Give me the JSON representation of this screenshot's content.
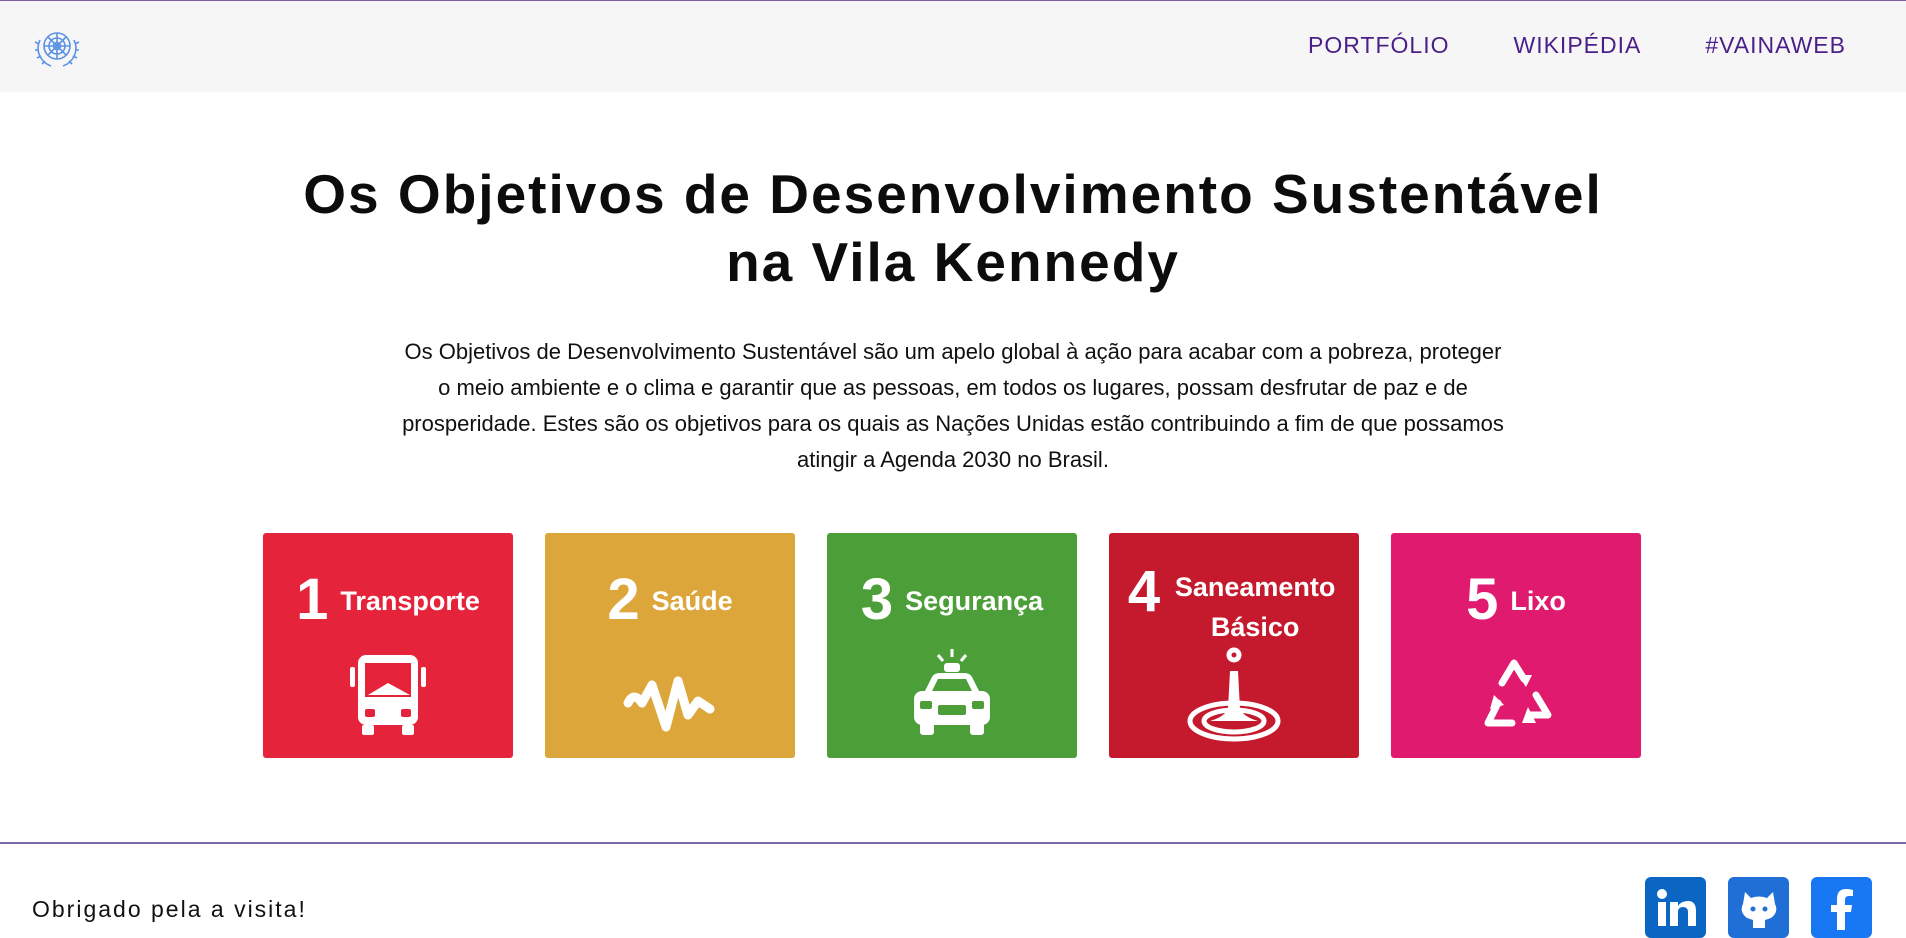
{
  "header": {
    "logo_name": "un-emblem-icon",
    "nav": [
      "PORTFÓLIO",
      "WIKIPÉDIA",
      "#VAINAWEB"
    ]
  },
  "main": {
    "title_line1": "Os Objetivos de Desenvolvimento Sustentável",
    "title_line2": "na Vila Kennedy",
    "intro": "Os Objetivos de Desenvolvimento Sustentável são um apelo global à ação para acabar com a pobreza, proteger o meio ambiente e o clima e garantir que as pessoas, em todos os lugares, possam desfrutar de paz e de prosperidade. Estes são os objetivos para os quais as Nações Unidas estão contribuindo a fim de que possamos atingir a Agenda 2030 no Brasil.",
    "cards": [
      {
        "number": "1",
        "label": "Transporte",
        "color": "#e5243b",
        "icon": "bus-icon"
      },
      {
        "number": "2",
        "label": "Saúde",
        "color": "#dda63a",
        "icon": "heartbeat-icon"
      },
      {
        "number": "3",
        "label": "Segurança",
        "color": "#4c9f38",
        "icon": "police-car-icon"
      },
      {
        "number": "4",
        "label": "Saneamento Básico",
        "color": "#c5192d",
        "icon": "water-drop-icon"
      },
      {
        "number": "5",
        "label": "Lixo",
        "color": "#e01a6e",
        "icon": "recycle-icon"
      }
    ]
  },
  "footer": {
    "text": "Obrigado pela a visita!",
    "social": [
      "linkedin-icon",
      "github-icon",
      "facebook-icon"
    ]
  },
  "colors": {
    "nav_link": "#4b1f88",
    "accent_line": "#7b6aa5"
  }
}
